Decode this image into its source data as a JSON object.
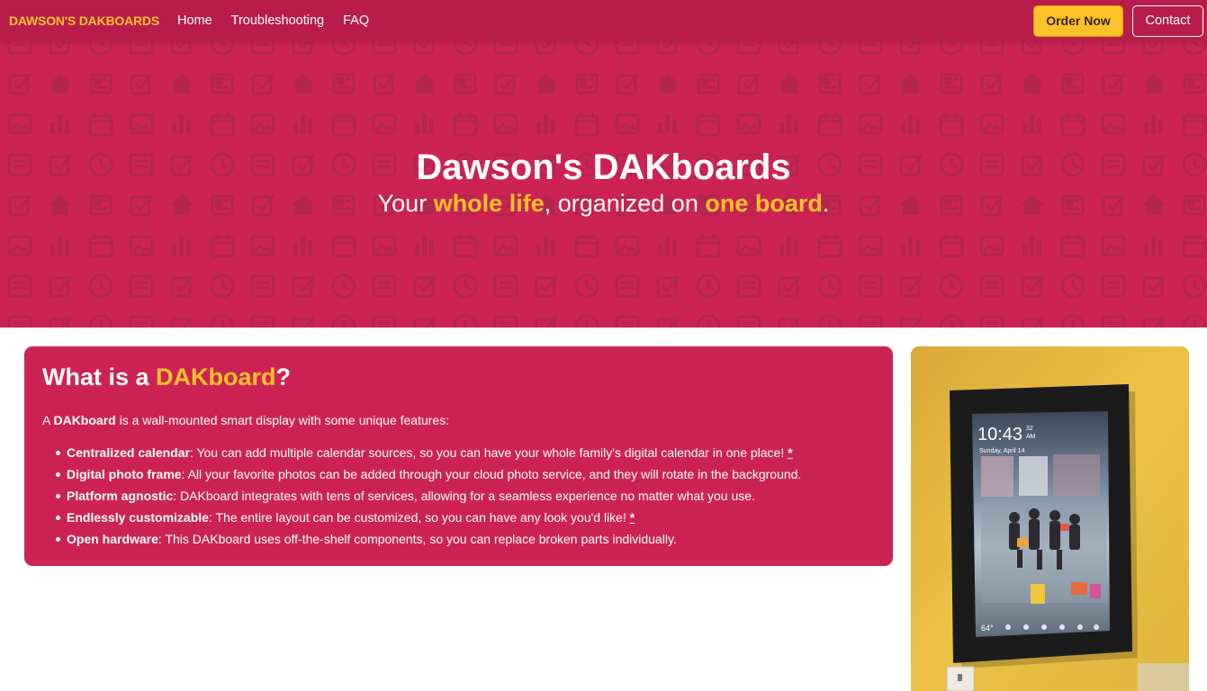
{
  "navbar": {
    "brand": "DAWSON'S DAKBOARDS",
    "links": [
      "Home",
      "Troubleshooting",
      "FAQ"
    ],
    "order_button": "Order Now",
    "contact_button": "Contact"
  },
  "hero": {
    "title": "Dawson's DAKboards",
    "subtitle_pre": "Your ",
    "subtitle_hl1": "whole life",
    "subtitle_mid": ", organized on ",
    "subtitle_hl2": "one board",
    "subtitle_post": "."
  },
  "card": {
    "title_pre": "What is a ",
    "title_hl": "DAKboard",
    "title_post": "?",
    "intro_pre": "A ",
    "intro_bold": "DAKboard",
    "intro_post": " is a wall-mounted smart display with some unique features:",
    "features": [
      {
        "name": "Centralized calendar",
        "text": ": You can add multiple calendar sources, so you can have your whole family's digital calendar in one place! ",
        "note": "*"
      },
      {
        "name": "Digital photo frame",
        "text": ": All your favorite photos can be added through your cloud photo service, and they will rotate in the background.",
        "note": ""
      },
      {
        "name": "Platform agnostic",
        "text": ": DAKboard integrates with tens of services, allowing for a seamless experience no matter what you use.",
        "note": ""
      },
      {
        "name": "Endlessly customizable",
        "text": ": The entire layout can be customized, so you can have any look you'd like! ",
        "note": "*"
      },
      {
        "name": "Open hardware",
        "text": ": This DAKboard uses off-the-shelf components, so you can replace broken parts individually.",
        "note": ""
      }
    ]
  },
  "photo": {
    "clock_time": "10:43",
    "clock_seconds": "32",
    "clock_ampm": "AM",
    "date": "Sunday, April 14",
    "temperature": "64°"
  },
  "colors": {
    "brand_red": "#cd2354",
    "nav_red": "#b81c4b",
    "accent_yellow": "#fdc22a"
  }
}
